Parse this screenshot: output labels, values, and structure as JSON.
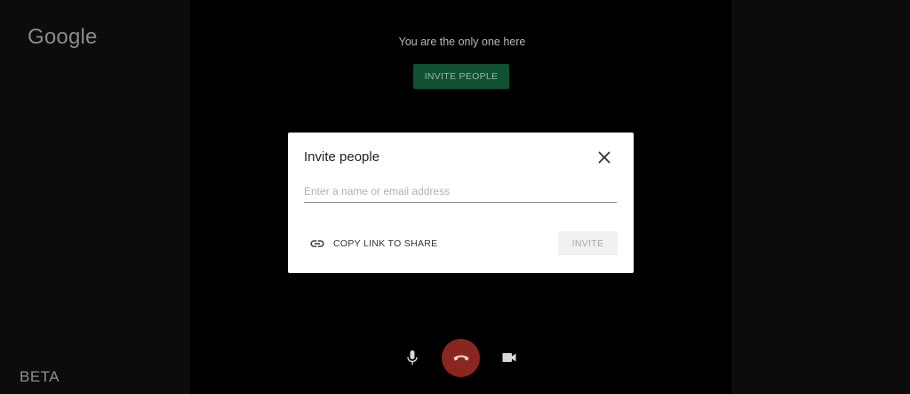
{
  "brand": {
    "logo_text": "Google",
    "beta_label": "BETA"
  },
  "meeting": {
    "status_text": "You are the only one here",
    "invite_people_button": "INVITE PEOPLE"
  },
  "dialog": {
    "title": "Invite people",
    "input_placeholder": "Enter a name or email address",
    "input_value": "",
    "copy_link_label": "COPY LINK TO SHARE",
    "invite_button": "INVITE"
  },
  "controls": {
    "mic_icon": "microphone-icon",
    "hangup_icon": "phone-hangup-icon",
    "camera_icon": "video-camera-icon"
  },
  "colors": {
    "invite_people_bg": "#0f5132",
    "hangup_bg": "#8a2620",
    "dialog_bg": "#ffffff",
    "backdrop": "#000000"
  }
}
